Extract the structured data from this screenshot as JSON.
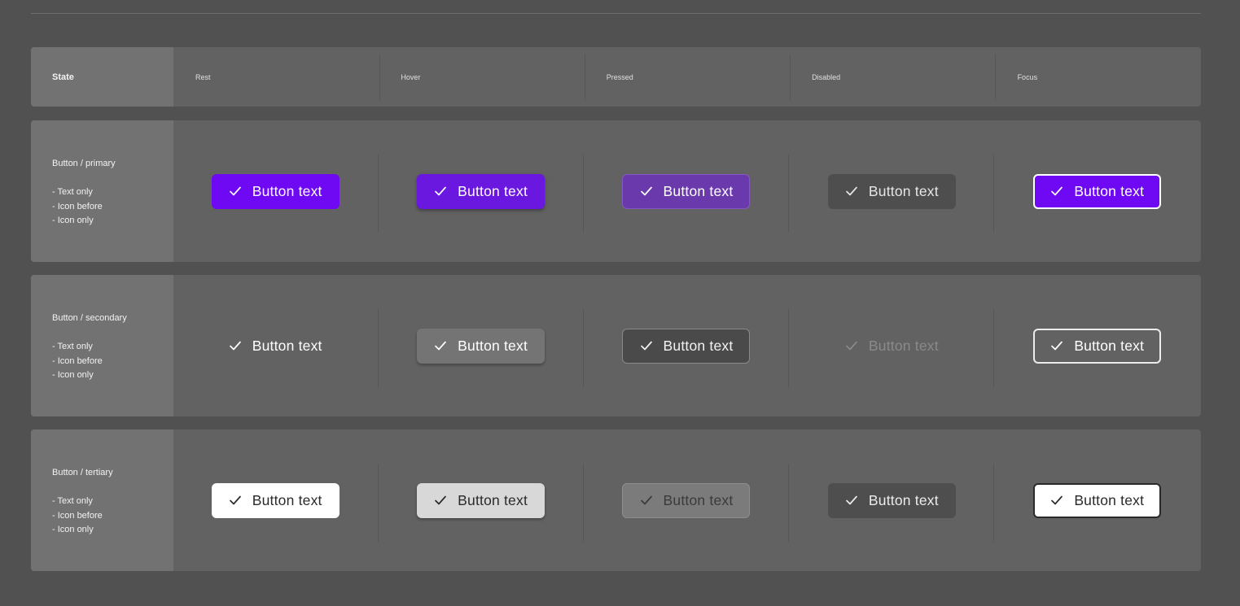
{
  "header": {
    "state_label": "State",
    "columns": [
      "Rest",
      "Hover",
      "Pressed",
      "Disabled",
      "Focus"
    ]
  },
  "rows": [
    {
      "title": "Button / primary",
      "variants": [
        "- Text only",
        "- Icon before",
        "- Icon only"
      ],
      "buttons": [
        "Button text",
        "Button text",
        "Button text",
        "Button text",
        "Button text"
      ]
    },
    {
      "title": "Button / secondary",
      "variants": [
        "- Text only",
        "- Icon before",
        "- Icon only"
      ],
      "buttons": [
        "Button text",
        "Button text",
        "Button text",
        "Button text",
        "Button text"
      ]
    },
    {
      "title": "Button / tertiary",
      "variants": [
        "- Text only",
        "- Icon before",
        "- Icon only"
      ],
      "buttons": [
        "Button text",
        "Button text",
        "Button text",
        "Button text",
        "Button text"
      ]
    }
  ],
  "colors": {
    "background": "#515151",
    "panel": "#626262",
    "label_column": "#727272",
    "primary": "#6f08f3",
    "primary_hover": "#6a18e0",
    "primary_pressed": "#6a3aad"
  },
  "icons": {
    "button_icon": "check-icon"
  }
}
